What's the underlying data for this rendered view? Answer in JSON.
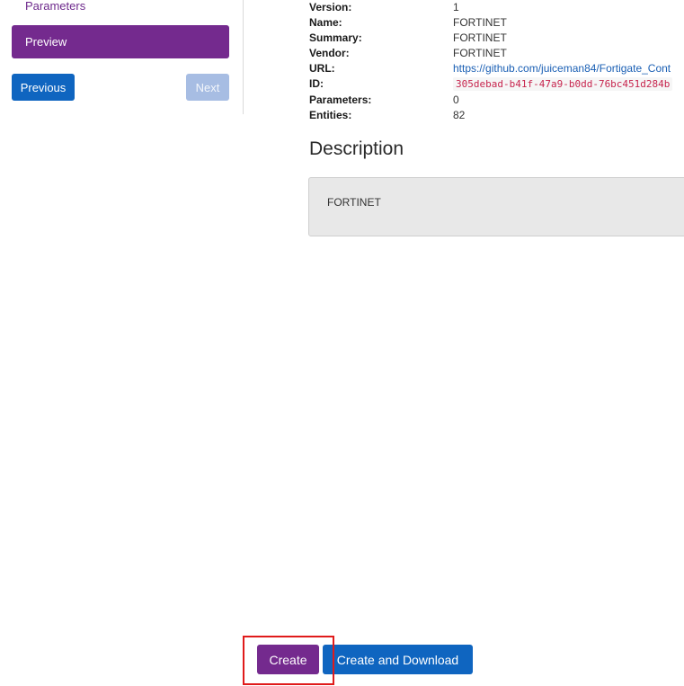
{
  "sidebar": {
    "items": [
      {
        "label": "Parameters"
      },
      {
        "label": "Preview",
        "active": true
      }
    ],
    "previous_label": "Previous",
    "next_label": "Next"
  },
  "details": {
    "rows": [
      {
        "label": "Version:",
        "value": "1"
      },
      {
        "label": "Name:",
        "value": "FORTINET"
      },
      {
        "label": "Summary:",
        "value": "FORTINET"
      },
      {
        "label": "Vendor:",
        "value": "FORTINET"
      },
      {
        "label": "URL:",
        "value": "https://github.com/juiceman84/Fortigate_Cont"
      },
      {
        "label": "ID:",
        "value": "305debad-b41f-47a9-b0dd-76bc451d284b"
      },
      {
        "label": "Parameters:",
        "value": "0"
      },
      {
        "label": "Entities:",
        "value": "82"
      }
    ]
  },
  "description": {
    "heading": "Description",
    "text": "FORTINET"
  },
  "actions": {
    "create_label": "Create",
    "create_download_label": "Create and Download"
  },
  "colors": {
    "accent_purple": "#742a8e",
    "primary_blue": "#0f65c0",
    "disabled_blue": "#a7bde3",
    "highlight_red": "#e01b1b"
  }
}
